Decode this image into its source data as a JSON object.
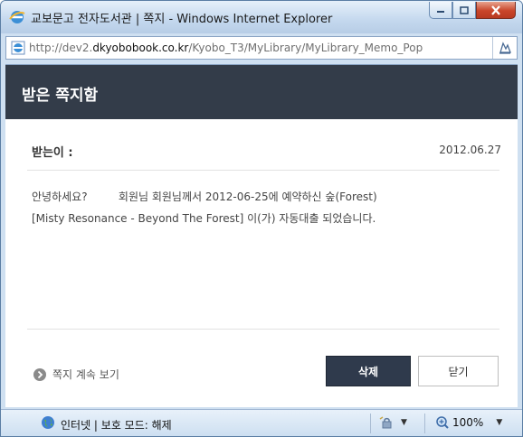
{
  "window": {
    "title": "교보문고 전자도서관 | 쪽지 - Windows Internet Explorer",
    "icon": "ie-icon",
    "buttons": [
      "minimize-icon",
      "maximize-icon",
      "close-icon"
    ]
  },
  "address": {
    "prefix": "http://dev2.",
    "domain": "dkyobobook.co.kr",
    "path": "/Kyobo_T3/MyLibrary/MyLibrary_Memo_Pop",
    "compat_icon": "compatibility-view-icon"
  },
  "page": {
    "title": "받은 쪽지함",
    "from_label": "받는이 :",
    "date": "2012.06.27",
    "message_line1": "안녕하세요?         회원님 회원님께서 2012-06-25에 예약하신 숲(Forest)",
    "message_line2": "[Misty Resonance - Beyond The Forest] 이(가) 자동대출 되었습니다.",
    "more_link": "쪽지 계속 보기",
    "delete_button": "삭제",
    "close_button": "닫기"
  },
  "status": {
    "zone": "인터넷 | 보호 모드: 해제",
    "zoom": "100%"
  },
  "colors": {
    "header_bg": "#333c49",
    "delete_bg": "#2f3a4c"
  }
}
